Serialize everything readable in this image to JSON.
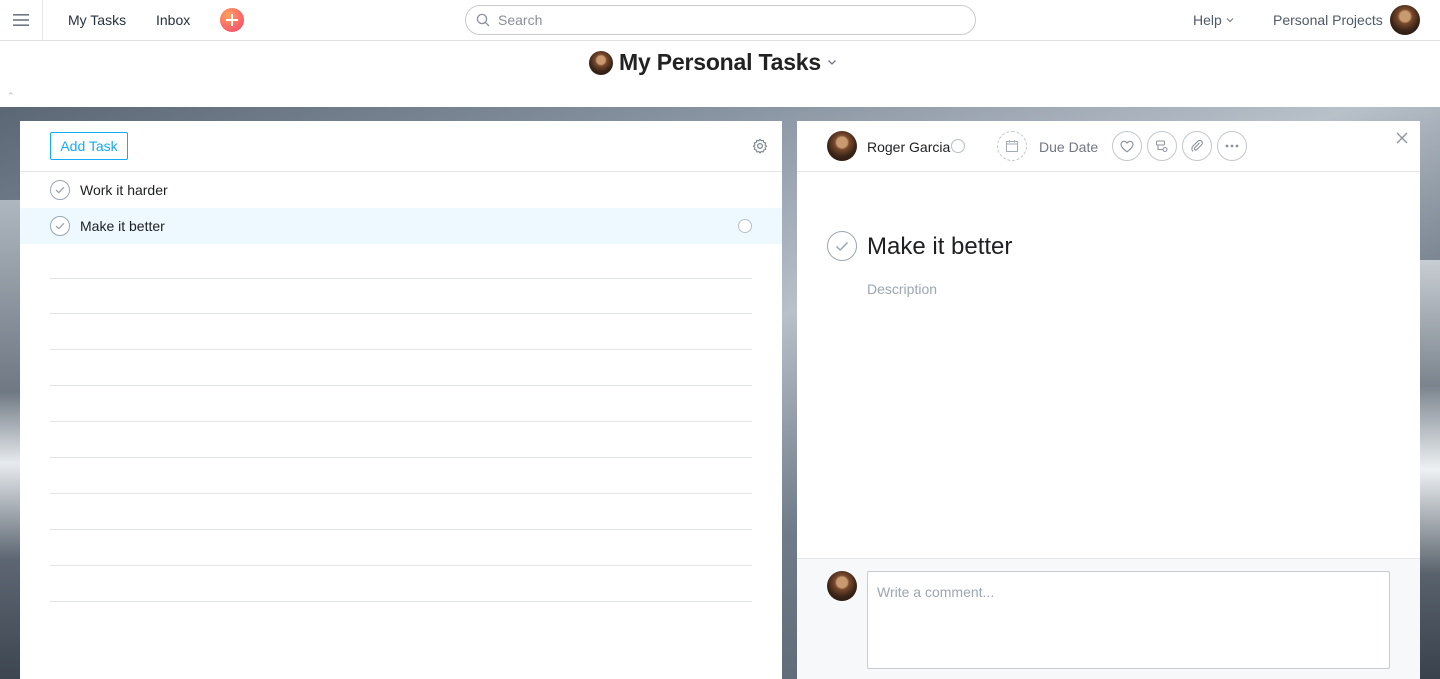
{
  "topbar": {
    "menu_icon": "hamburger-menu-icon",
    "my_tasks": "My Tasks",
    "inbox": "Inbox",
    "quick_add_icon": "plus-icon",
    "search_placeholder": "Search",
    "help": "Help",
    "organization": "Personal Projects"
  },
  "header": {
    "title": "My Personal Tasks"
  },
  "task_list": {
    "add_task_label": "Add Task",
    "tasks": [
      {
        "name": "Work it harder",
        "selected": false
      },
      {
        "name": "Make it better",
        "selected": true
      }
    ]
  },
  "task_detail": {
    "assignee": "Roger Garcia",
    "due_date_label": "Due Date",
    "title": "Make it better",
    "description_placeholder": "Description",
    "comment_placeholder": "Write a comment..."
  },
  "colors": {
    "accent": "#14aaf5",
    "selected_row": "#edf8ff"
  }
}
